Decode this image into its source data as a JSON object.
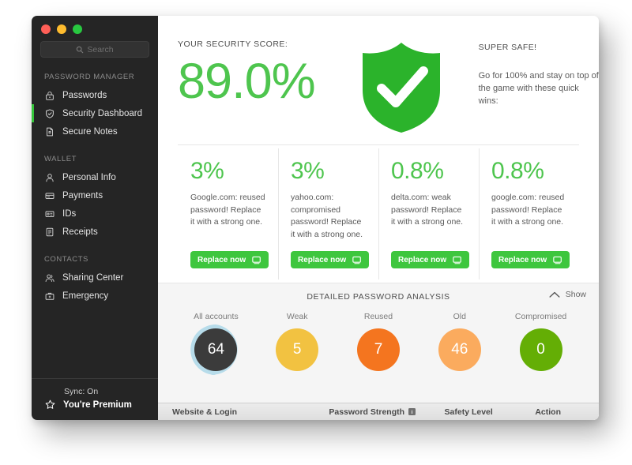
{
  "window": {
    "traffic_lights": [
      "close",
      "minimize",
      "zoom"
    ]
  },
  "sidebar": {
    "search": {
      "placeholder": "Search",
      "value": "",
      "icon": "search-icon"
    },
    "groups": [
      {
        "title": "PASSWORD MANAGER",
        "items": [
          {
            "label": "Passwords",
            "icon": "lock-icon",
            "active": false
          },
          {
            "label": "Security Dashboard",
            "icon": "shield-icon",
            "active": true
          },
          {
            "label": "Secure Notes",
            "icon": "note-icon",
            "active": false
          }
        ]
      },
      {
        "title": "WALLET",
        "items": [
          {
            "label": "Personal Info",
            "icon": "person-icon",
            "active": false
          },
          {
            "label": "Payments",
            "icon": "card-icon",
            "active": false
          },
          {
            "label": "IDs",
            "icon": "id-icon",
            "active": false
          },
          {
            "label": "Receipts",
            "icon": "receipt-icon",
            "active": false
          }
        ]
      },
      {
        "title": "CONTACTS",
        "items": [
          {
            "label": "Sharing Center",
            "icon": "people-icon",
            "active": false
          },
          {
            "label": "Emergency",
            "icon": "briefcase-icon",
            "active": false
          }
        ]
      }
    ],
    "footer": {
      "sync": "Sync: On",
      "premium": "You're Premium",
      "premium_icon": "star-icon"
    }
  },
  "score": {
    "label": "YOUR SECURITY SCORE:",
    "value": "89.0%",
    "shield_icon": "shield-check-icon",
    "status_title": "SUPER SAFE!",
    "status_text": "Go for 100% and stay on top of the game with these quick wins:"
  },
  "quick_wins": {
    "button_icon": "monitor-icon",
    "cards": [
      {
        "percent": "3%",
        "desc": "Google.com: reused password! Replace it with a strong one.",
        "button": "Replace now"
      },
      {
        "percent": "3%",
        "desc": "yahoo.com: compromised password! Replace it with a strong one.",
        "button": "Replace now"
      },
      {
        "percent": "0.8%",
        "desc": "delta.com: weak password! Replace it with a strong one.",
        "button": "Replace now"
      },
      {
        "percent": "0.8%",
        "desc": "google.com: reused password! Replace it with a strong one.",
        "button": "Replace now"
      }
    ]
  },
  "analysis": {
    "title": "DETAILED PASSWORD ANALYSIS",
    "toggle_label": "Show",
    "toggle_icon": "chevron-up-icon",
    "stats": [
      {
        "label": "All accounts",
        "value": "64",
        "color": "#3b3b3b",
        "ring": "#b7dcea"
      },
      {
        "label": "Weak",
        "value": "5",
        "color": "#f2c241",
        "ring": ""
      },
      {
        "label": "Reused",
        "value": "7",
        "color": "#f4751f",
        "ring": ""
      },
      {
        "label": "Old",
        "value": "46",
        "color": "#fbab5e",
        "ring": ""
      },
      {
        "label": "Compromised",
        "value": "0",
        "color": "#64ae05",
        "ring": ""
      }
    ]
  },
  "table": {
    "columns": [
      {
        "label": "Website & Login",
        "icon": ""
      },
      {
        "label": "Password Strength",
        "icon": "info-icon"
      },
      {
        "label": "Safety Level",
        "icon": ""
      },
      {
        "label": "Action",
        "icon": ""
      }
    ]
  },
  "colors": {
    "accent_green": "#3ec63e",
    "score_green": "#4ec54e",
    "sidebar_bg": "#252525",
    "panel_bg": "#f5f5f5"
  }
}
